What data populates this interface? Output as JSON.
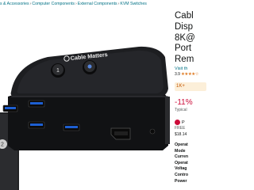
{
  "breadcrumb": {
    "items": [
      "s & Accessories",
      "Computer Components",
      "External Components",
      "KVM Switches"
    ],
    "separator": "›"
  },
  "product": {
    "title_lines": [
      "Cabl",
      "Disp",
      "8K@",
      "Port",
      "Rem"
    ],
    "store_link": "Visit th",
    "rating_value": "3.9",
    "stars": "★★★★☆",
    "badge": "1K+",
    "discount": "-11%",
    "typical_price": "Typical",
    "prime_label": "P",
    "prime_sub": "FREE",
    "shipping": "$18.14",
    "specs": [
      "Operat",
      "Mode",
      "Curren",
      "Operat",
      "Voltag",
      "Contro",
      "Power"
    ]
  },
  "image": {
    "brand_logo": "Cable Matters",
    "button_1": "1",
    "button_2": "2",
    "remote_button": "2"
  },
  "colors": {
    "link": "#007185",
    "price_red": "#cc0c39",
    "star": "#de7921",
    "device_body": "#1c1d1f",
    "usb_blue": "#1e5fd1"
  }
}
